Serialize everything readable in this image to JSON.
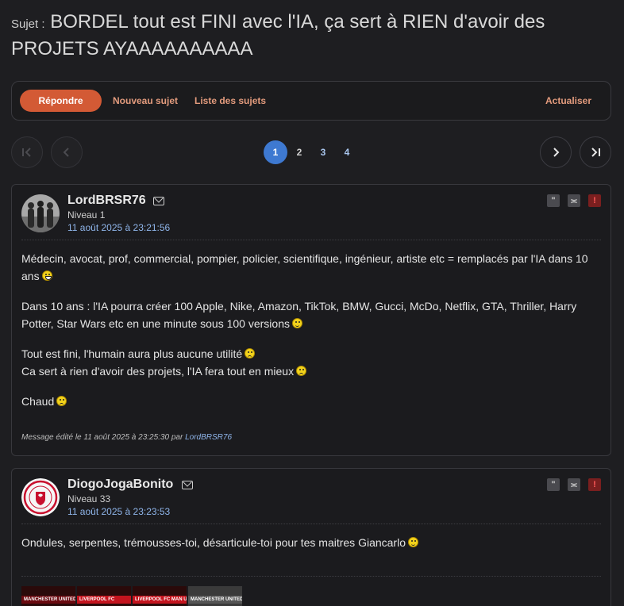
{
  "topic": {
    "prefix": "Sujet :",
    "title": "BORDEL tout est FINI avec l'IA, ça sert à RIEN d'avoir des PROJETS AYAAAAAAAAAA"
  },
  "actions": {
    "reply": "Répondre",
    "new_topic": "Nouveau sujet",
    "topic_list": "Liste des sujets",
    "refresh": "Actualiser"
  },
  "pagination": {
    "pages": [
      "1",
      "2",
      "3",
      "4"
    ],
    "current": "1"
  },
  "posts": [
    {
      "author": "LordBRSR76",
      "level": "Niveau 1",
      "date": "11 août 2025 à 23:21:56",
      "paragraphs": [
        "Médecin, avocat, prof, commercial, pompier, policier, scientifique, ingénieur, artiste etc = remplacés par l'IA dans 10 ans",
        "Dans 10 ans : l'IA pourra créer 100 Apple, Nike, Amazon, TikTok, BMW, Gucci, McDo, Netflix, GTA, Thriller, Harry Potter, Star Wars etc en une minute sous 100 versions",
        "Tout est fini, l'humain aura plus aucune utilité",
        "Ca sert à rien d'avoir des projets, l'IA fera tout en mieux",
        "Chaud"
      ],
      "edited_prefix": "Message édité le 11 août 2025 à 23:25:30 par",
      "edited_by": "LordBRSR76"
    },
    {
      "author": "DiogoJogaBonito",
      "level": "Niveau 33",
      "date": "11 août 2025 à 23:23:53",
      "paragraphs": [
        "Ondules, serpentes, trémousses-toi, désarticule-toi pour tes maitres Giancarlo"
      ],
      "thumbnails": [
        "MANCHESTER UNITED",
        "LIVERPOOL FC",
        "LIVERPOOL FC MAN UNITED",
        "MANCHESTER UNITED"
      ]
    }
  ],
  "colors": {
    "accent": "#d35a35",
    "link": "#8fb5ea",
    "page_current": "#3e79d1"
  }
}
